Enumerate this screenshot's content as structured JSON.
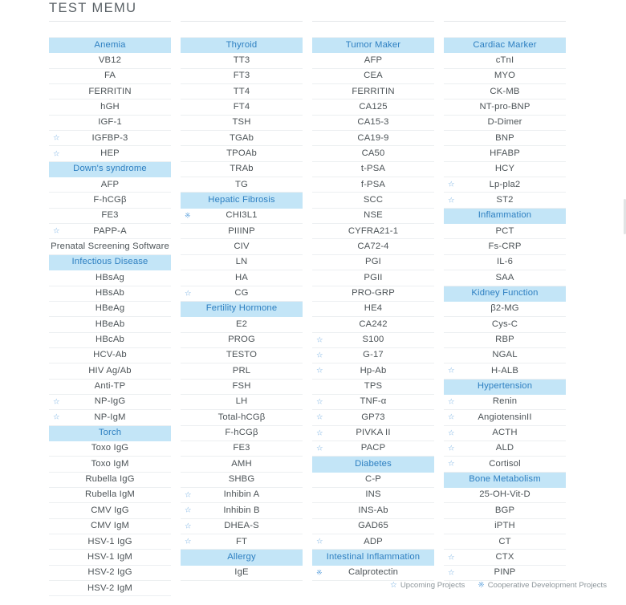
{
  "page": {
    "title": "TEST MEMU"
  },
  "legend": {
    "items": [
      {
        "glyph": "☆",
        "label": "Upcoming Projects",
        "name": "upcoming-projects"
      },
      {
        "glyph": "※",
        "label": "Cooperative Development Projects",
        "name": "cooperative-development-projects"
      }
    ]
  },
  "marks": {
    "upcoming": "☆",
    "cooperative": "※"
  },
  "colors": {
    "group_header_bg": "#c3e5f7",
    "group_header_text": "#2d7fc1",
    "row_text": "#4c5357",
    "mark": "#6aa9e0",
    "row_divider": "#eceff1"
  },
  "columns": [
    {
      "name": "column-1",
      "rows": [
        {
          "label": "Anemia",
          "type": "group"
        },
        {
          "label": "VB12",
          "type": "item"
        },
        {
          "label": "FA",
          "type": "item"
        },
        {
          "label": "FERRITIN",
          "type": "item"
        },
        {
          "label": "hGH",
          "type": "item"
        },
        {
          "label": "IGF-1",
          "type": "item"
        },
        {
          "label": "IGFBP-3",
          "type": "item",
          "mark": "upcoming"
        },
        {
          "label": "HEP",
          "type": "item",
          "mark": "upcoming"
        },
        {
          "label": "Down's syndrome",
          "type": "group"
        },
        {
          "label": "AFP",
          "type": "item"
        },
        {
          "label": "F-hCGβ",
          "type": "item"
        },
        {
          "label": "FE3",
          "type": "item"
        },
        {
          "label": "PAPP-A",
          "type": "item",
          "mark": "upcoming"
        },
        {
          "label": "Prenatal Screening Software",
          "type": "item"
        },
        {
          "label": "Infectious Disease",
          "type": "group"
        },
        {
          "label": "HBsAg",
          "type": "item"
        },
        {
          "label": "HBsAb",
          "type": "item"
        },
        {
          "label": "HBeAg",
          "type": "item"
        },
        {
          "label": "HBeAb",
          "type": "item"
        },
        {
          "label": "HBcAb",
          "type": "item"
        },
        {
          "label": "HCV-Ab",
          "type": "item"
        },
        {
          "label": "HIV Ag/Ab",
          "type": "item"
        },
        {
          "label": "Anti-TP",
          "type": "item"
        },
        {
          "label": "NP-IgG",
          "type": "item",
          "mark": "upcoming"
        },
        {
          "label": "NP-IgM",
          "type": "item",
          "mark": "upcoming"
        },
        {
          "label": "Torch",
          "type": "group"
        },
        {
          "label": "Toxo IgG",
          "type": "item"
        },
        {
          "label": "Toxo IgM",
          "type": "item"
        },
        {
          "label": "Rubella IgG",
          "type": "item"
        },
        {
          "label": "Rubella IgM",
          "type": "item"
        },
        {
          "label": "CMV IgG",
          "type": "item"
        },
        {
          "label": "CMV IgM",
          "type": "item"
        },
        {
          "label": "HSV-1 IgG",
          "type": "item"
        },
        {
          "label": "HSV-1 IgM",
          "type": "item"
        },
        {
          "label": "HSV-2 IgG",
          "type": "item"
        },
        {
          "label": "HSV-2 IgM",
          "type": "item"
        }
      ]
    },
    {
      "name": "column-2",
      "rows": [
        {
          "label": "Thyroid",
          "type": "group"
        },
        {
          "label": "TT3",
          "type": "item"
        },
        {
          "label": "FT3",
          "type": "item"
        },
        {
          "label": "TT4",
          "type": "item"
        },
        {
          "label": "FT4",
          "type": "item"
        },
        {
          "label": "TSH",
          "type": "item"
        },
        {
          "label": "TGAb",
          "type": "item"
        },
        {
          "label": "TPOAb",
          "type": "item"
        },
        {
          "label": "TRAb",
          "type": "item"
        },
        {
          "label": "TG",
          "type": "item"
        },
        {
          "label": "Hepatic Fibrosis",
          "type": "group"
        },
        {
          "label": "CHI3L1",
          "type": "item",
          "mark": "cooperative"
        },
        {
          "label": "PIIINP",
          "type": "item"
        },
        {
          "label": "CIV",
          "type": "item"
        },
        {
          "label": "LN",
          "type": "item"
        },
        {
          "label": "HA",
          "type": "item"
        },
        {
          "label": "CG",
          "type": "item",
          "mark": "upcoming"
        },
        {
          "label": "Fertility Hormone",
          "type": "group"
        },
        {
          "label": "E2",
          "type": "item"
        },
        {
          "label": "PROG",
          "type": "item"
        },
        {
          "label": "TESTO",
          "type": "item"
        },
        {
          "label": "PRL",
          "type": "item"
        },
        {
          "label": "FSH",
          "type": "item"
        },
        {
          "label": "LH",
          "type": "item"
        },
        {
          "label": "Total-hCGβ",
          "type": "item"
        },
        {
          "label": "F-hCGβ",
          "type": "item"
        },
        {
          "label": "FE3",
          "type": "item"
        },
        {
          "label": "AMH",
          "type": "item"
        },
        {
          "label": "SHBG",
          "type": "item"
        },
        {
          "label": "Inhibin A",
          "type": "item",
          "mark": "upcoming"
        },
        {
          "label": "Inhibin B",
          "type": "item",
          "mark": "upcoming"
        },
        {
          "label": "DHEA-S",
          "type": "item",
          "mark": "upcoming"
        },
        {
          "label": "FT",
          "type": "item",
          "mark": "upcoming"
        },
        {
          "label": "Allergy",
          "type": "group"
        },
        {
          "label": "IgE",
          "type": "item"
        }
      ]
    },
    {
      "name": "column-3",
      "rows": [
        {
          "label": "Tumor Maker",
          "type": "group"
        },
        {
          "label": "AFP",
          "type": "item"
        },
        {
          "label": "CEA",
          "type": "item"
        },
        {
          "label": "FERRITIN",
          "type": "item"
        },
        {
          "label": "CA125",
          "type": "item"
        },
        {
          "label": "CA15-3",
          "type": "item"
        },
        {
          "label": "CA19-9",
          "type": "item"
        },
        {
          "label": "CA50",
          "type": "item"
        },
        {
          "label": "t-PSA",
          "type": "item"
        },
        {
          "label": "f-PSA",
          "type": "item"
        },
        {
          "label": "SCC",
          "type": "item"
        },
        {
          "label": "NSE",
          "type": "item"
        },
        {
          "label": "CYFRA21-1",
          "type": "item"
        },
        {
          "label": "CA72-4",
          "type": "item"
        },
        {
          "label": "PGI",
          "type": "item"
        },
        {
          "label": "PGII",
          "type": "item"
        },
        {
          "label": "PRO-GRP",
          "type": "item"
        },
        {
          "label": "HE4",
          "type": "item"
        },
        {
          "label": "CA242",
          "type": "item"
        },
        {
          "label": "S100",
          "type": "item",
          "mark": "upcoming"
        },
        {
          "label": "G-17",
          "type": "item",
          "mark": "upcoming"
        },
        {
          "label": "Hp-Ab",
          "type": "item",
          "mark": "upcoming"
        },
        {
          "label": "TPS",
          "type": "item"
        },
        {
          "label": "TNF-α",
          "type": "item",
          "mark": "upcoming"
        },
        {
          "label": "GP73",
          "type": "item",
          "mark": "upcoming"
        },
        {
          "label": "PIVKA II",
          "type": "item",
          "mark": "upcoming"
        },
        {
          "label": "PACP",
          "type": "item",
          "mark": "upcoming"
        },
        {
          "label": "Diabetes",
          "type": "group"
        },
        {
          "label": "C-P",
          "type": "item"
        },
        {
          "label": "INS",
          "type": "item"
        },
        {
          "label": "INS-Ab",
          "type": "item"
        },
        {
          "label": "GAD65",
          "type": "item"
        },
        {
          "label": "ADP",
          "type": "item",
          "mark": "upcoming"
        },
        {
          "label": "Intestinal Inflammation",
          "type": "group"
        },
        {
          "label": "Calprotectin",
          "type": "item",
          "mark": "cooperative"
        }
      ]
    },
    {
      "name": "column-4",
      "rows": [
        {
          "label": "Cardiac Marker",
          "type": "group"
        },
        {
          "label": "cTnI",
          "type": "item"
        },
        {
          "label": "MYO",
          "type": "item"
        },
        {
          "label": "CK-MB",
          "type": "item"
        },
        {
          "label": "NT-pro-BNP",
          "type": "item"
        },
        {
          "label": "D-Dimer",
          "type": "item"
        },
        {
          "label": "BNP",
          "type": "item"
        },
        {
          "label": "HFABP",
          "type": "item"
        },
        {
          "label": "HCY",
          "type": "item"
        },
        {
          "label": "Lp-pla2",
          "type": "item",
          "mark": "upcoming"
        },
        {
          "label": "ST2",
          "type": "item",
          "mark": "upcoming"
        },
        {
          "label": "Inflammation",
          "type": "group"
        },
        {
          "label": "PCT",
          "type": "item"
        },
        {
          "label": "Fs-CRP",
          "type": "item"
        },
        {
          "label": "IL-6",
          "type": "item"
        },
        {
          "label": "SAA",
          "type": "item"
        },
        {
          "label": "Kidney Function",
          "type": "group"
        },
        {
          "label": "β2-MG",
          "type": "item"
        },
        {
          "label": "Cys-C",
          "type": "item"
        },
        {
          "label": "RBP",
          "type": "item"
        },
        {
          "label": "NGAL",
          "type": "item"
        },
        {
          "label": "H-ALB",
          "type": "item",
          "mark": "upcoming"
        },
        {
          "label": "Hypertension",
          "type": "group"
        },
        {
          "label": "Renin",
          "type": "item",
          "mark": "upcoming"
        },
        {
          "label": "AngiotensinII",
          "type": "item",
          "mark": "upcoming"
        },
        {
          "label": "ACTH",
          "type": "item",
          "mark": "upcoming"
        },
        {
          "label": "ALD",
          "type": "item",
          "mark": "upcoming"
        },
        {
          "label": "Cortisol",
          "type": "item",
          "mark": "upcoming"
        },
        {
          "label": "Bone Metabolism",
          "type": "group"
        },
        {
          "label": "25-OH-Vit-D",
          "type": "item"
        },
        {
          "label": "BGP",
          "type": "item"
        },
        {
          "label": "iPTH",
          "type": "item"
        },
        {
          "label": "CT",
          "type": "item"
        },
        {
          "label": "CTX",
          "type": "item",
          "mark": "upcoming"
        },
        {
          "label": "PINP",
          "type": "item",
          "mark": "upcoming"
        }
      ]
    }
  ]
}
